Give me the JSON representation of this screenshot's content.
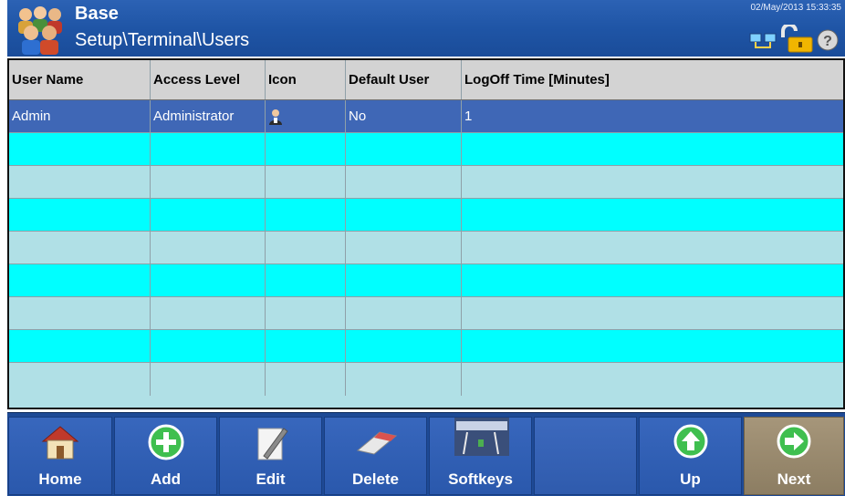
{
  "header": {
    "app_name": "Base",
    "breadcrumb": "Setup\\Terminal\\Users",
    "datetime": "02/May/2013 15:33:35",
    "status_icons": [
      "network-icon",
      "unlock-icon",
      "help-icon"
    ]
  },
  "table": {
    "columns": [
      "User Name",
      "Access Level",
      "Icon",
      "Default User",
      "LogOff Time [Minutes]"
    ],
    "rows": [
      {
        "user_name": "Admin",
        "access_level": "Administrator",
        "icon": "user-avatar-icon",
        "default_user": "No",
        "logoff_time": "1",
        "selected": true
      }
    ],
    "empty_rows": 8
  },
  "softkeys": [
    {
      "label": "Home",
      "icon": "home-icon"
    },
    {
      "label": "Add",
      "icon": "plus-circle-icon"
    },
    {
      "label": "Edit",
      "icon": "edit-pen-icon"
    },
    {
      "label": "Delete",
      "icon": "eraser-icon"
    },
    {
      "label": "Softkeys",
      "icon": "softkeys-icon"
    },
    {
      "label": "",
      "icon": ""
    },
    {
      "label": "Up",
      "icon": "arrow-up-circle-icon"
    },
    {
      "label": "Next",
      "icon": "arrow-right-circle-icon"
    }
  ],
  "colors": {
    "header_blue": "#1f55a6",
    "selected_row": "#3f67b6",
    "row_cyan": "#00ffff",
    "row_pale": "#b0e0e6",
    "header_row": "#d3d3d3",
    "softkey_blue": "#2a58ac",
    "softkey_next": "#8c7d62"
  }
}
